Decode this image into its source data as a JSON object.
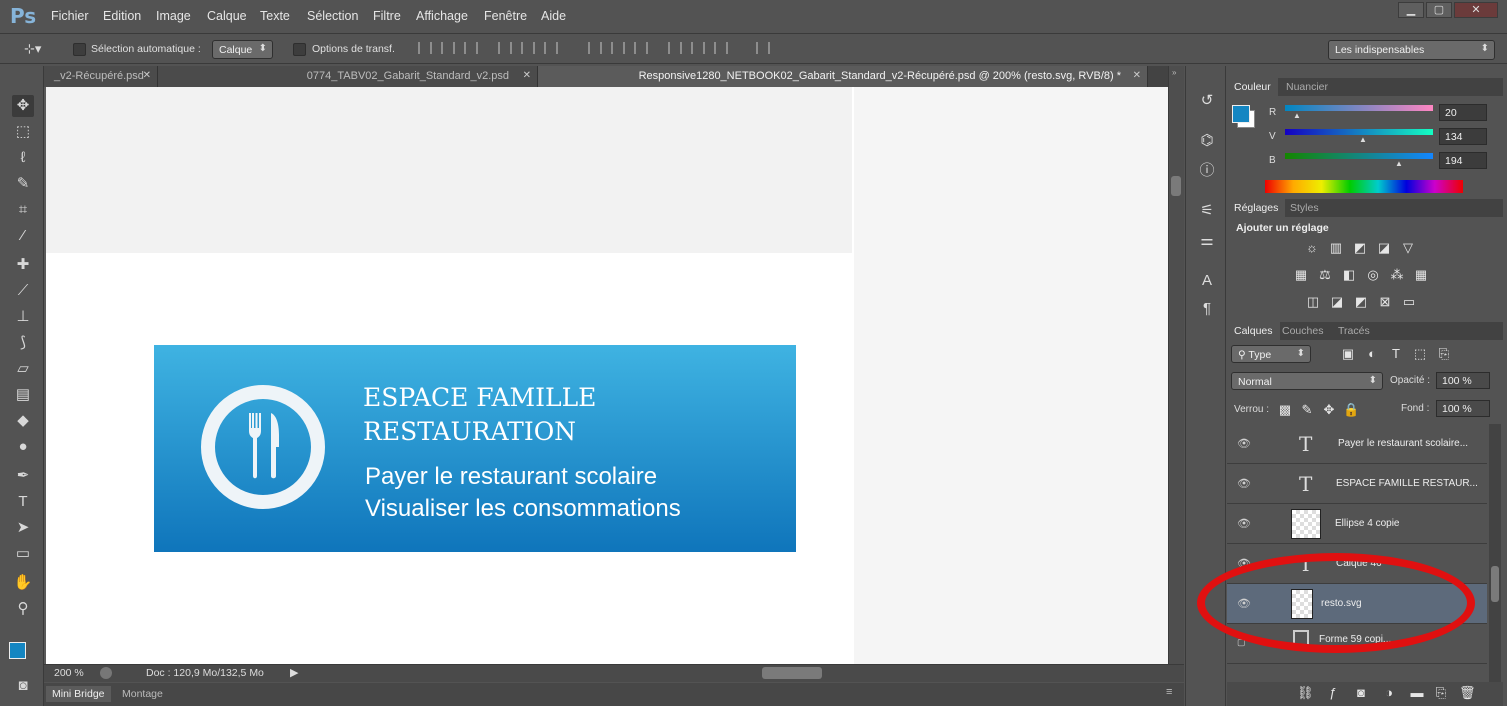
{
  "app": {
    "logo": "Ps"
  },
  "menu": [
    "Fichier",
    "Edition",
    "Image",
    "Calque",
    "Texte",
    "Sélection",
    "Filtre",
    "Affichage",
    "Fenêtre",
    "Aide"
  ],
  "window_controls": [
    "▁",
    "▢",
    "✕"
  ],
  "options": {
    "auto_select_label": "Sélection automatique :",
    "auto_select_value": "Calque",
    "transform_label": "Options de transf.",
    "workspace": "Les indispensables"
  },
  "doc_tabs": [
    {
      "label": "_v2-Récupéré.psd"
    },
    {
      "label": "0774_TABV02_Gabarit_Standard_v2.psd"
    },
    {
      "label": "Responsive1280_NETBOOK02_Gabarit_Standard_v2-Récupéré.psd @ 200% (resto.svg, RVB/8) *"
    }
  ],
  "banner": {
    "title": "ESPACE FAMILLE\nRESTAURATION",
    "line1": "Payer le restaurant scolaire",
    "line2": "Visualiser les consommations"
  },
  "status": {
    "zoom": "200 %",
    "doc": "Doc : 120,9 Mo/132,5 Mo"
  },
  "bottom_tabs": [
    "Mini Bridge",
    "Montage"
  ],
  "color_panel": {
    "tabs": [
      "Couleur",
      "Nuancier"
    ],
    "r_label": "R",
    "v_label": "V",
    "b_label": "B",
    "r": "20",
    "v": "134",
    "b": "194",
    "swatch": "#1486c2"
  },
  "adjust_panel": {
    "tabs": [
      "Réglages",
      "Styles"
    ],
    "heading": "Ajouter un réglage"
  },
  "layers_panel": {
    "tabs": [
      "Calques",
      "Couches",
      "Tracés"
    ],
    "filter": "Type",
    "blend": "Normal",
    "opacity_label": "Opacité :",
    "opacity": "100 %",
    "lock_label": "Verrou :",
    "fill_label": "Fond :",
    "fill": "100 %",
    "layers": [
      {
        "name": "Payer le restaurant scolaire..."
      },
      {
        "name": "ESPACE FAMILLE  RESTAUR..."
      },
      {
        "name": "Ellipse 4 copie"
      },
      {
        "name": "Calque 46"
      },
      {
        "name": "resto.svg"
      },
      {
        "name": "Forme 59 copi..."
      }
    ]
  },
  "colors": {
    "highlight": "#e01010",
    "banner_top": "#3fb3e2",
    "banner_bottom": "#0f75bb"
  }
}
